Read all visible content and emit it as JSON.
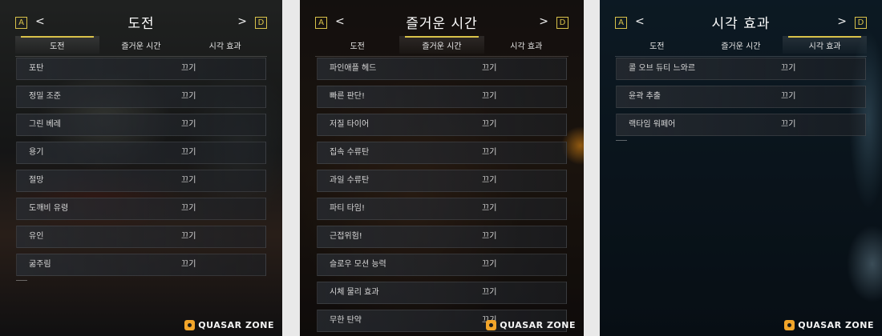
{
  "tabs": [
    "도전",
    "즐거운 시간",
    "시각 효과"
  ],
  "keys": {
    "left": "A",
    "right": "D"
  },
  "panels": [
    {
      "title": "도전",
      "active_tab": 0,
      "rows": [
        {
          "label": "포탄",
          "value": "끄기"
        },
        {
          "label": "정밀 조준",
          "value": "끄기"
        },
        {
          "label": "그린 베레",
          "value": "끄기"
        },
        {
          "label": "용기",
          "value": "끄기"
        },
        {
          "label": "절망",
          "value": "끄기"
        },
        {
          "label": "도깨비 유령",
          "value": "끄기"
        },
        {
          "label": "유인",
          "value": "끄기"
        },
        {
          "label": "굶주림",
          "value": "끄기"
        }
      ]
    },
    {
      "title": "즐거운 시간",
      "active_tab": 1,
      "rows": [
        {
          "label": "파인애플 헤드",
          "value": "끄기"
        },
        {
          "label": "빠른 판단!",
          "value": "끄기"
        },
        {
          "label": "저질 타이어",
          "value": "끄기"
        },
        {
          "label": "집속 수류탄",
          "value": "끄기"
        },
        {
          "label": "과일 수류탄",
          "value": "끄기"
        },
        {
          "label": "파티 타임!",
          "value": "끄기"
        },
        {
          "label": "근접위험!",
          "value": "끄기"
        },
        {
          "label": "슬로우 모션 능력",
          "value": "끄기"
        },
        {
          "label": "시체 물리 효과",
          "value": "끄기"
        },
        {
          "label": "무한 탄약",
          "value": "끄기"
        }
      ]
    },
    {
      "title": "시각 효과",
      "active_tab": 2,
      "rows": [
        {
          "label": "콜 오브 듀티 느와르",
          "value": "끄기"
        },
        {
          "label": "윤곽 추출",
          "value": "끄기"
        },
        {
          "label": "랙타임 워페어",
          "value": "끄기"
        }
      ]
    }
  ],
  "watermark": "QUASAR ZONE",
  "colors": {
    "accent": "#d9c24a",
    "logo": "#f2a52a"
  }
}
